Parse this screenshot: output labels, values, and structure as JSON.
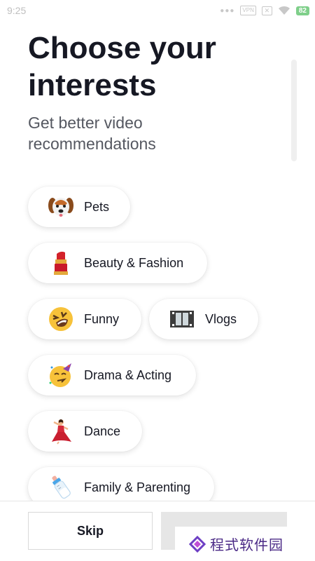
{
  "status_bar": {
    "time": "9:25",
    "vpn": "VPN",
    "battery": "82"
  },
  "header": {
    "title": "Choose your interests",
    "subtitle": "Get better video recommendations"
  },
  "interests": [
    {
      "label": "Pets",
      "icon": "dog-face-icon"
    },
    {
      "label": "Beauty & Fashion",
      "icon": "lipstick-icon"
    },
    {
      "label": "Funny",
      "icon": "laughing-face-icon"
    },
    {
      "label": "Vlogs",
      "icon": "film-frames-icon"
    },
    {
      "label": "Drama & Acting",
      "icon": "partying-face-icon"
    },
    {
      "label": "Dance",
      "icon": "dancer-icon"
    },
    {
      "label": "Family & Parenting",
      "icon": "baby-bottle-icon"
    }
  ],
  "footer": {
    "skip_label": "Skip",
    "watermark": "程式软件园"
  },
  "colors": {
    "text": "#161823",
    "subtitle": "#555861",
    "next_disabled": "#e6e6e6",
    "battery": "#7fcf8a",
    "watermark": "#4b2a86"
  }
}
